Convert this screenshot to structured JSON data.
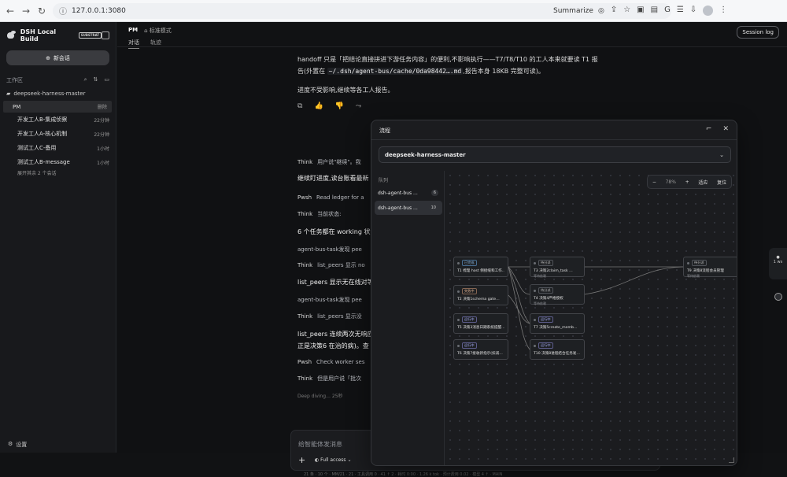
{
  "browser": {
    "url": "127.0.0.1:3080",
    "summarize": "Summarize"
  },
  "sidebar": {
    "brand": "DSH Local Build",
    "badge": "SUBSTRAT",
    "newchat": "新会话",
    "workspace": "工作区",
    "project": "deepseek-harness-master",
    "pm": "PM",
    "delete": "删除",
    "items": [
      {
        "label": "开发工人B-集成侦察",
        "time": "22分钟"
      },
      {
        "label": "开发工人A-核心机制",
        "time": "22分钟"
      },
      {
        "label": "测试工人C-备用",
        "time": "1小时"
      },
      {
        "label": "测试工人B-message",
        "time": "1小时"
      }
    ],
    "more": "展开其余 2 个会话",
    "settings": "设置"
  },
  "header": {
    "title": "PM",
    "mode": "标准模式",
    "tabs": [
      "对话",
      "轨迹"
    ],
    "session": "Session log"
  },
  "chat": {
    "line1a": "handoff 只是「把结论直接拼进下游任务内容」的便利,不影响执行——T7/T8/T10 的工人本来就要读 T1 报",
    "line1b_pre": "告(外置在 ",
    "line1b_code": "~/.dsh/agent-bus/cache/0da98442….md",
    "line1b_post": ",报告本身 18KB 完整可读)。",
    "line2": "进度不受影响,继续等各工人报告。",
    "think1_label": "Think",
    "think1": "用户说\"继续\"。我",
    "heading1": "继续盯进度,读台账看最新",
    "pwsh1_label": "Pwsh",
    "pwsh1": "Read ledger for a",
    "think2_label": "Think",
    "think2": "当前状态:",
    "heading2": "6 个任务都在 working 状",
    "task1": "agent-bus-task发现 pee",
    "think3_label": "Think",
    "think3": "list_peers 显示 no",
    "heading3": "list_peers 显示无在线对等",
    "task2": "agent-bus-task发现 pee",
    "think4_label": "Think",
    "think4": "list_peers 显示没",
    "heading4a": "list_peers 连续两次无响应",
    "heading4b": "正是决策6 在治的病)。查",
    "pwsh2_label": "Pwsh",
    "pwsh2": "Check worker ses",
    "think5_label": "Think",
    "think5": "但是用户说「批次",
    "deep": "Deep diving… 25秒"
  },
  "composer": {
    "placeholder": "给智能体发消息",
    "access": "Full access"
  },
  "footer": "21 条 · 10 个 · MM/21 · 21 · 工具调用 0 · 41 ↑ 2 · 耗时 0:00 · 1.26 k tok · 预计费用 0.02 · 模型 4 ↑ · MAIN",
  "overlay": {
    "title": "流程",
    "repo": "deepseek-harness-master",
    "group": "队列",
    "buses": [
      {
        "name": "dsh-agent-bus ...",
        "count": "6"
      },
      {
        "name": "dsh-agent-bus ...",
        "count": "10"
      }
    ],
    "zoom": {
      "minus": "−",
      "pct": "78%",
      "plus": "+",
      "fit": "适应",
      "reset": "复位"
    },
    "nodes": [
      {
        "status": "已完成",
        "title": "T1 梳理 host 侧接缝和工作…",
        "sub": "",
        "cls": "tag-done"
      },
      {
        "status": "失败中",
        "title": "T2 决策1schema gate…",
        "sub": "",
        "cls": "tag-fail"
      },
      {
        "status": "运行中",
        "title": "T5 决策3消息日期系统提醒…",
        "sub": "",
        "cls": "tag-run"
      },
      {
        "status": "运行中",
        "title": "T6 决策7接收新指示(扣减…",
        "sub": "",
        "cls": "tag-run"
      },
      {
        "status": "待分派",
        "title": "T3 决策2claim_task …",
        "sub": "等待依赖",
        "cls": "tag-wait"
      },
      {
        "status": "待分派",
        "title": "T4 决策4严格授权",
        "sub": "等待依赖",
        "cls": "tag-wait"
      },
      {
        "status": "运行中",
        "title": "T7 决策5create_memb…",
        "sub": "",
        "cls": "tag-run"
      },
      {
        "status": "运行中",
        "title": "T10 决策8进程结合任务发…",
        "sub": "",
        "cls": "tag-run"
      },
      {
        "status": "待分派",
        "title": "T9 决策8流程会员管理",
        "sub": "等待依赖",
        "cls": "tag-wait"
      }
    ]
  },
  "float": {
    "label": "1 ws"
  }
}
